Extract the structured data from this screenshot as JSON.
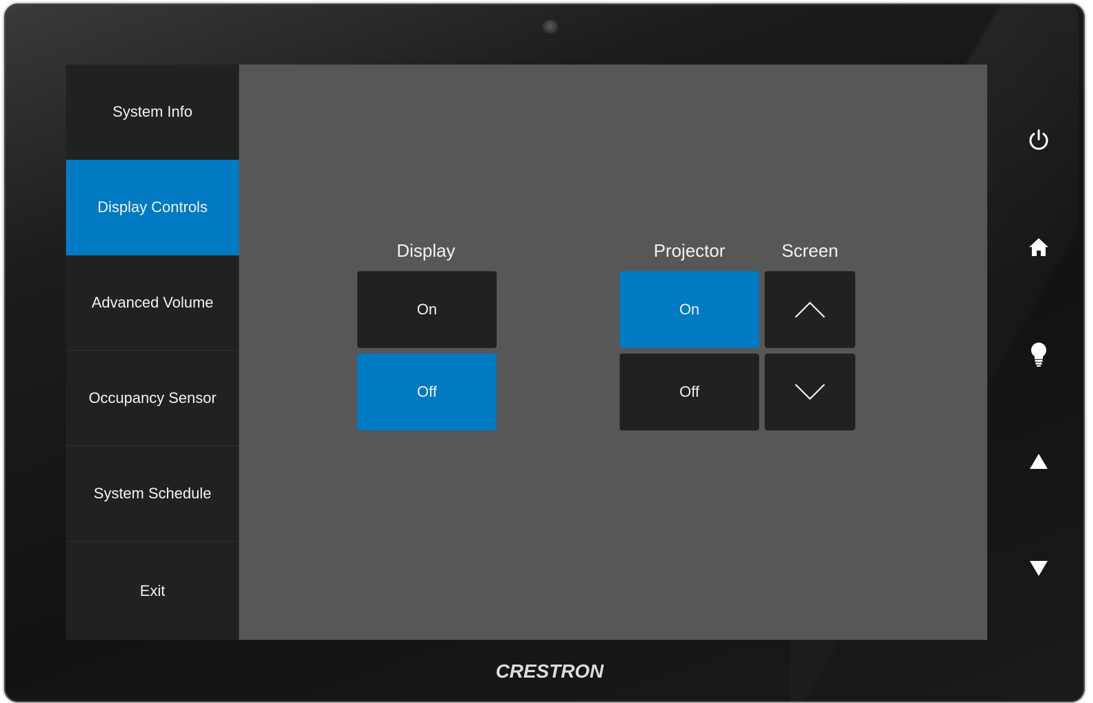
{
  "device": {
    "brand": "CRESTRON"
  },
  "sidebar": {
    "items": [
      {
        "label": "System Info",
        "active": false
      },
      {
        "label": "Display Controls",
        "active": true
      },
      {
        "label": "Advanced Volume",
        "active": false
      },
      {
        "label": "Occupancy Sensor",
        "active": false
      },
      {
        "label": "System Schedule",
        "active": false
      },
      {
        "label": "Exit",
        "active": false
      }
    ]
  },
  "main": {
    "display": {
      "label": "Display",
      "on_label": "On",
      "off_label": "Off",
      "state": "Off"
    },
    "projector": {
      "label": "Projector",
      "on_label": "On",
      "off_label": "Off",
      "state": "On"
    },
    "screen": {
      "label": "Screen",
      "up_icon": "chevron-up-icon",
      "down_icon": "chevron-down-icon"
    }
  },
  "hard_keys": [
    "power-icon",
    "home-icon",
    "lightbulb-icon",
    "arrow-up-icon",
    "arrow-down-icon"
  ],
  "colors": {
    "accent": "#007ac3",
    "button": "#202221",
    "background": "#575757",
    "sidebar": "#202221"
  }
}
